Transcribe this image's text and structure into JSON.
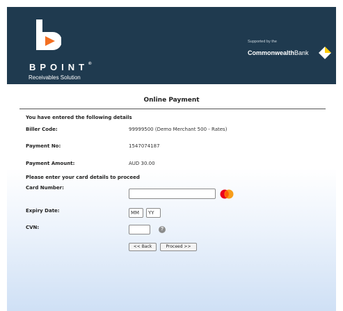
{
  "header": {
    "brand_name": "BPOINT",
    "brand_tm": "®",
    "brand_subtitle": "Receivables Solution",
    "supported_by": "Supported by the",
    "bank_name_bold": "Commonwealth",
    "bank_name_rest": "Bank",
    "colors": {
      "background": "#1f3a4f",
      "logo_accent": "#f36f21",
      "bank_diamond_yellow": "#ffcc00"
    }
  },
  "page": {
    "title": "Online Payment",
    "details_heading": "You have entered the following details",
    "card_heading": "Please enter your card details to proceed"
  },
  "details": {
    "biller_code_label": "Biller Code:",
    "biller_code_value": "99999500 (Demo Merchant 500 - Rates)",
    "payment_no_label": "Payment No:",
    "payment_no_value": "1547074187",
    "payment_amount_label": "Payment Amount:",
    "payment_amount_value": "AUD 30.00"
  },
  "card_form": {
    "card_number_label": "Card Number:",
    "card_number_value": "",
    "card_brand_icon": "mastercard-icon",
    "expiry_label": "Expiry Date:",
    "expiry_month_value": "MM",
    "expiry_year_value": "YY",
    "cvn_label": "CVN:",
    "cvn_value": "",
    "cvn_help_icon": "question-icon",
    "cvn_help_glyph": "?"
  },
  "actions": {
    "back_label": "<< Back",
    "proceed_label": "Proceed >>"
  }
}
